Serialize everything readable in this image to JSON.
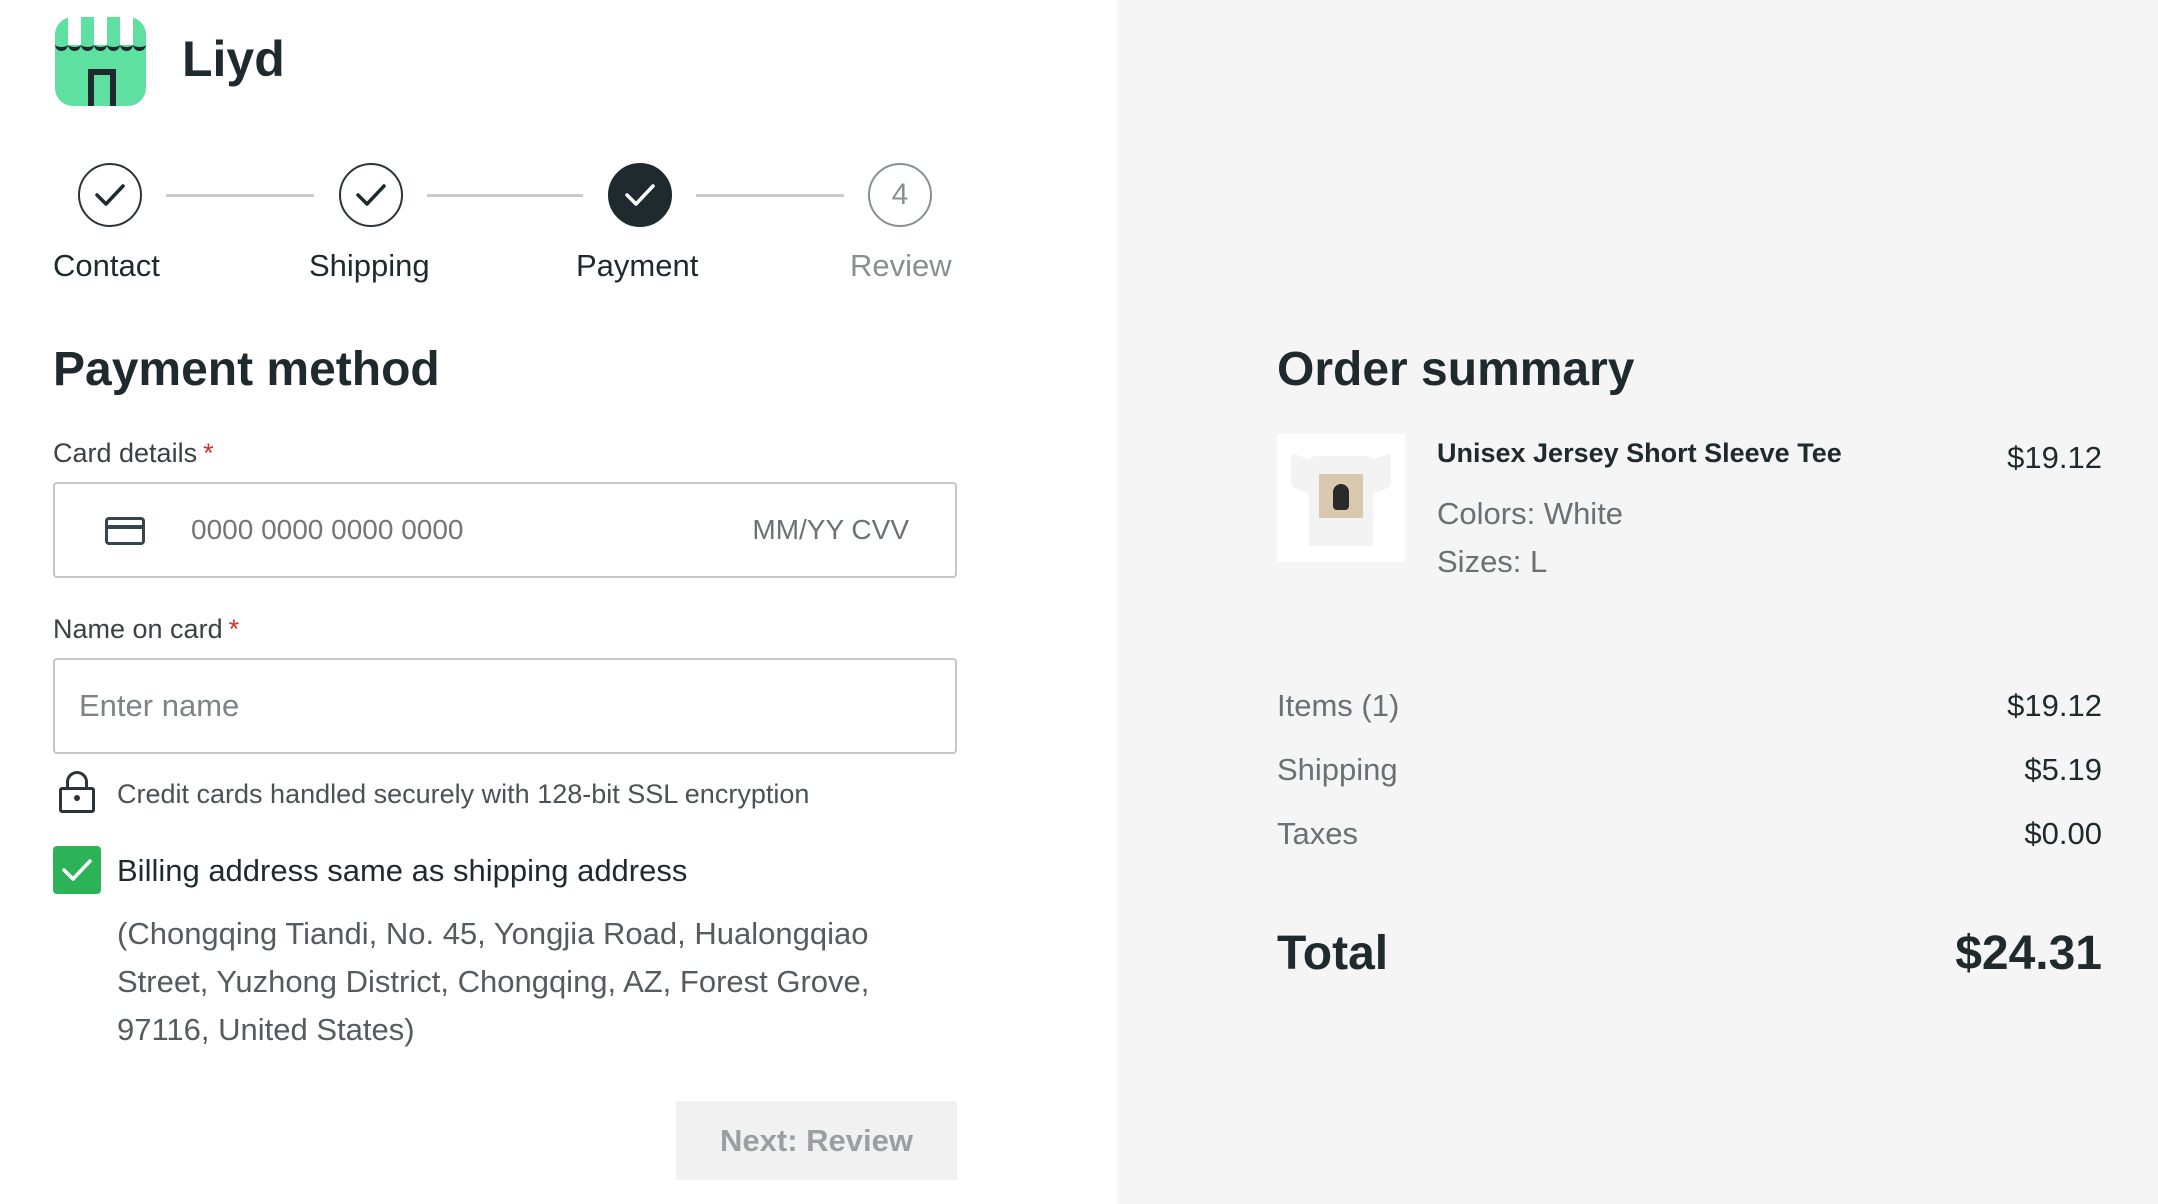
{
  "brand": {
    "name": "Liyd",
    "logo_color": "#5ee0a0"
  },
  "stepper": {
    "steps": [
      {
        "label": "Contact",
        "state": "complete",
        "icon": "check-icon"
      },
      {
        "label": "Shipping",
        "state": "complete",
        "icon": "check-icon"
      },
      {
        "label": "Payment",
        "state": "active",
        "icon": "check-icon"
      },
      {
        "label": "Review",
        "state": "upcoming",
        "number": "4"
      }
    ]
  },
  "payment": {
    "title": "Payment method",
    "card_label": "Card details",
    "required_mark": "*",
    "card_number_placeholder": "0000 0000 0000 0000",
    "card_expiry_placeholder": "MM/YY CVV",
    "name_label": "Name on card",
    "name_placeholder": "Enter name",
    "secure_note": "Credit cards handled securely with 128-bit SSL encryption",
    "billing_same_label": "Billing address same as shipping address",
    "billing_same_checked": true,
    "billing_address": "(Chongqing Tiandi, No. 45, Yongjia Road, Hualongqiao Street, Yuzhong District, Chongqing, AZ, Forest Grove, 97116, United States)",
    "next_button": "Next: Review",
    "accent_color": "#2cb357"
  },
  "summary": {
    "title": "Order summary",
    "item": {
      "name": "Unisex Jersey Short Sleeve Tee",
      "price": "$19.12",
      "color": "Colors: White",
      "size": "Sizes: L"
    },
    "rows": [
      {
        "label": "Items (1)",
        "value": "$19.12"
      },
      {
        "label": "Shipping",
        "value": "$5.19"
      },
      {
        "label": "Taxes",
        "value": "$0.00"
      }
    ],
    "total_label": "Total",
    "total_value": "$24.31"
  }
}
